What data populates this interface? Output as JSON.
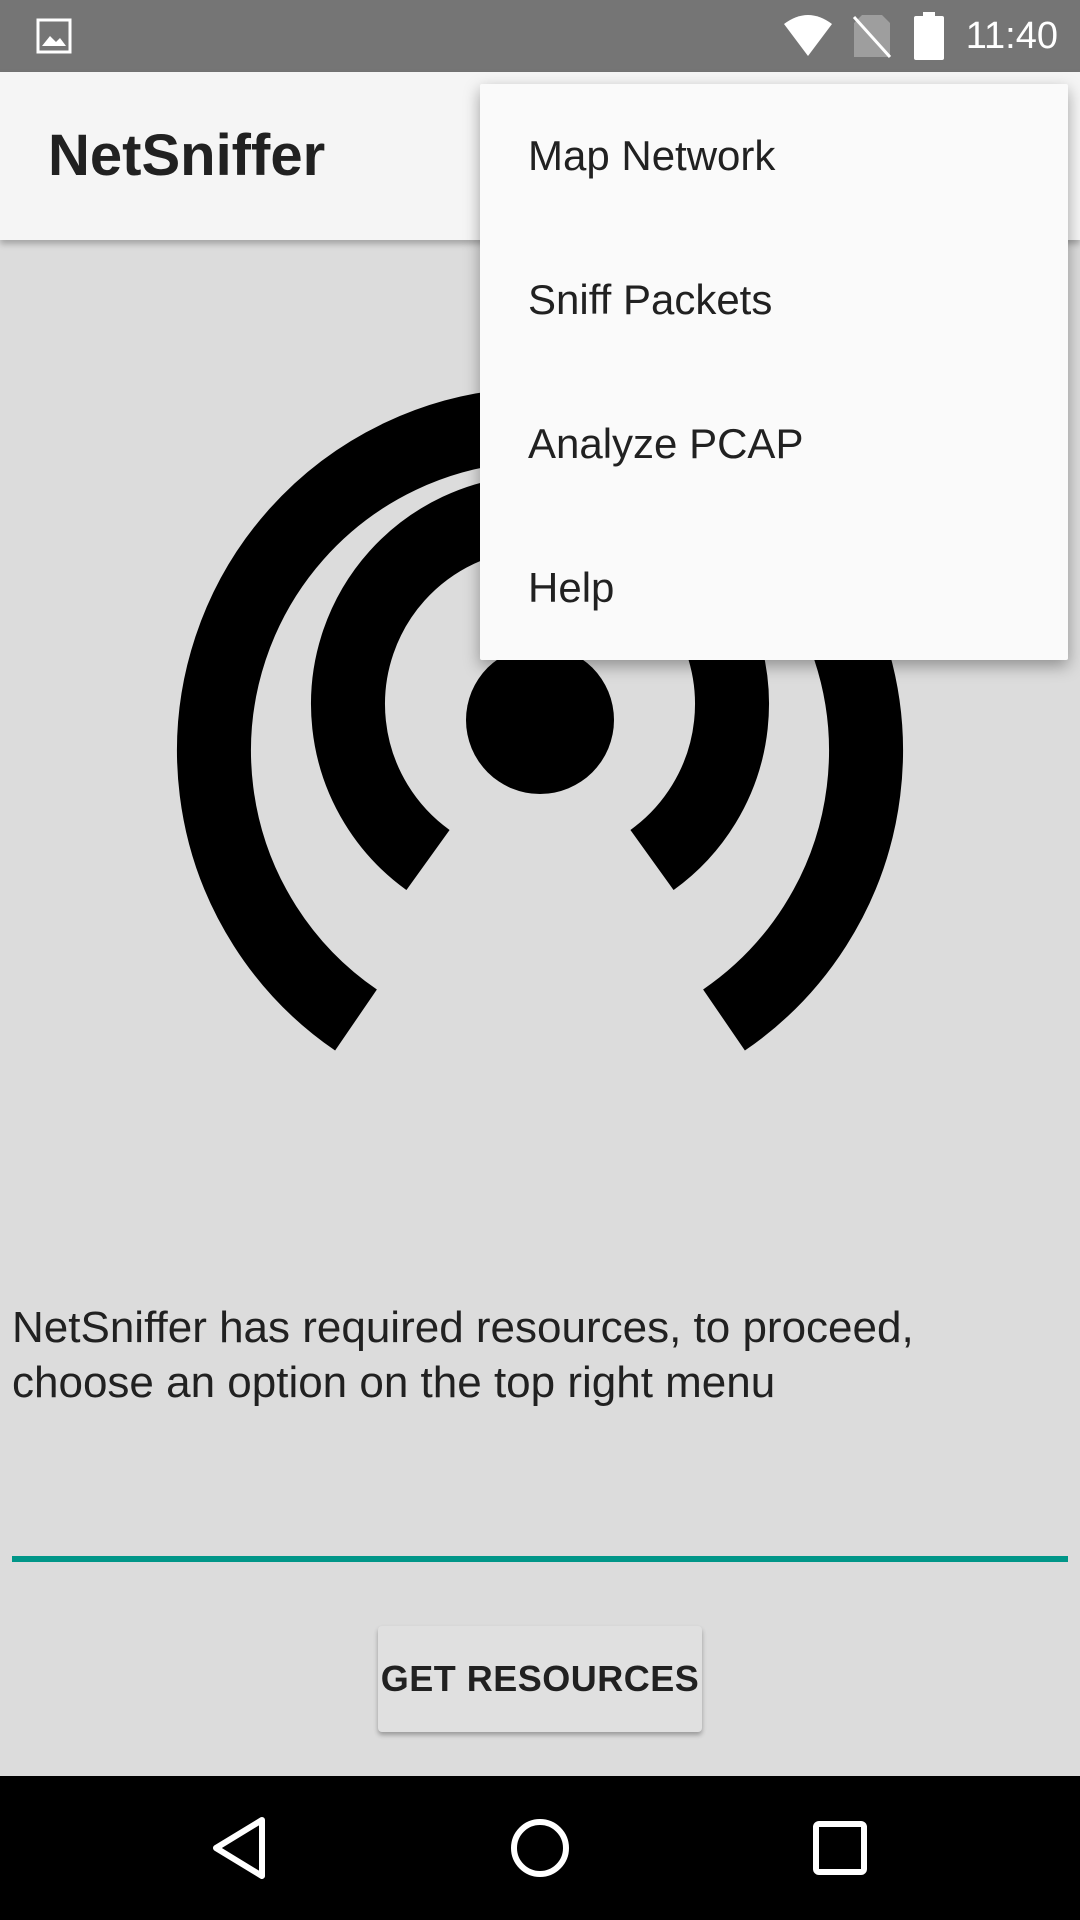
{
  "status_bar": {
    "time": "11:40",
    "icons": [
      "image-notification-icon",
      "wifi-icon",
      "no-sim-icon",
      "battery-icon"
    ]
  },
  "app_bar": {
    "title": "NetSniffer"
  },
  "overflow_menu": {
    "items": [
      {
        "label": "Map Network"
      },
      {
        "label": "Sniff Packets"
      },
      {
        "label": "Analyze PCAP"
      },
      {
        "label": "Help"
      }
    ]
  },
  "main": {
    "logo_icon": "broadcast-signal-icon",
    "message": "NetSniffer has required resources, to proceed, choose an option on the top right menu",
    "accent_color": "#009688",
    "button_label": "GET RESOURCES"
  },
  "nav_bar": {
    "icons": [
      "back-icon",
      "home-icon",
      "recents-icon"
    ]
  }
}
